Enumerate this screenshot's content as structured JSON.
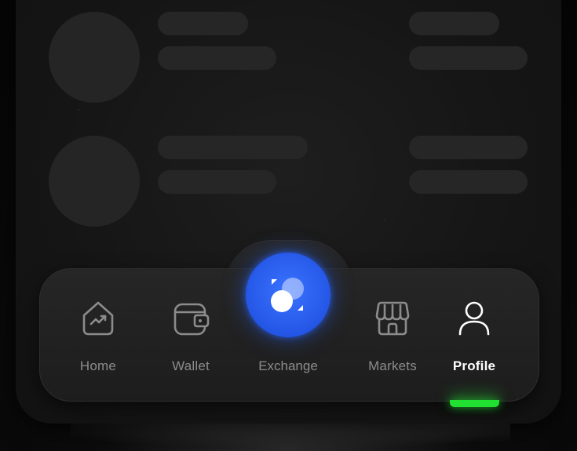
{
  "nav": {
    "items": [
      {
        "id": "home",
        "label": "Home",
        "icon": "home-chart-icon",
        "active": false
      },
      {
        "id": "wallet",
        "label": "Wallet",
        "icon": "wallet-icon",
        "active": false
      },
      {
        "id": "exchange",
        "label": "Exchange",
        "icon": "exchange-icon",
        "active": false
      },
      {
        "id": "markets",
        "label": "Markets",
        "icon": "storefront-icon",
        "active": false
      },
      {
        "id": "profile",
        "label": "Profile",
        "icon": "user-icon",
        "active": true
      }
    ]
  },
  "colors": {
    "accent_blue": "#2d66f5",
    "active_green": "#22e031",
    "inactive_text": "#8c8c8c",
    "active_text": "#ffffff"
  }
}
